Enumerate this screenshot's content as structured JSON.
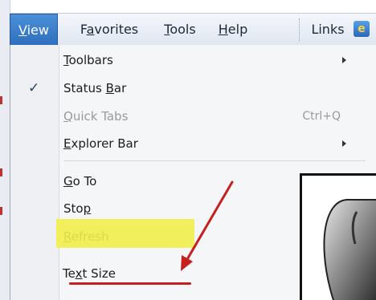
{
  "menubar": {
    "items": [
      {
        "label": "View",
        "accel": "V",
        "rest": "iew"
      },
      {
        "label": "Favorites",
        "accel": "a",
        "pre": "F",
        "rest": "vorites"
      },
      {
        "label": "Tools",
        "accel": "T",
        "rest": "ools"
      },
      {
        "label": "Help",
        "accel": "H",
        "rest": "elp"
      }
    ],
    "links_label": "Links",
    "links_icon": "ie-icon"
  },
  "menu": {
    "items": [
      {
        "pre": "",
        "accel": "T",
        "rest": "oolbars",
        "shortcut": "",
        "submenu": true
      },
      {
        "pre": "Status ",
        "accel": "B",
        "rest": "ar",
        "checked": true
      },
      {
        "pre": "",
        "accel": "Q",
        "rest": "uick Tabs",
        "shortcut": "Ctrl+Q",
        "disabled": true
      },
      {
        "pre": "",
        "accel": "E",
        "rest": "xplorer Bar",
        "shortcut": "",
        "submenu": true
      },
      {
        "pre": "",
        "accel": "G",
        "rest": "o To"
      },
      {
        "pre": "Sto",
        "accel": "p",
        "rest": ""
      },
      {
        "pre": "",
        "accel": "R",
        "rest": "efresh"
      },
      {
        "pre": "Te",
        "accel": "x",
        "rest": "t Size"
      }
    ]
  },
  "annotation": {
    "highlight_color": "#f1f04a",
    "arrow_color": "#c51f1f"
  }
}
